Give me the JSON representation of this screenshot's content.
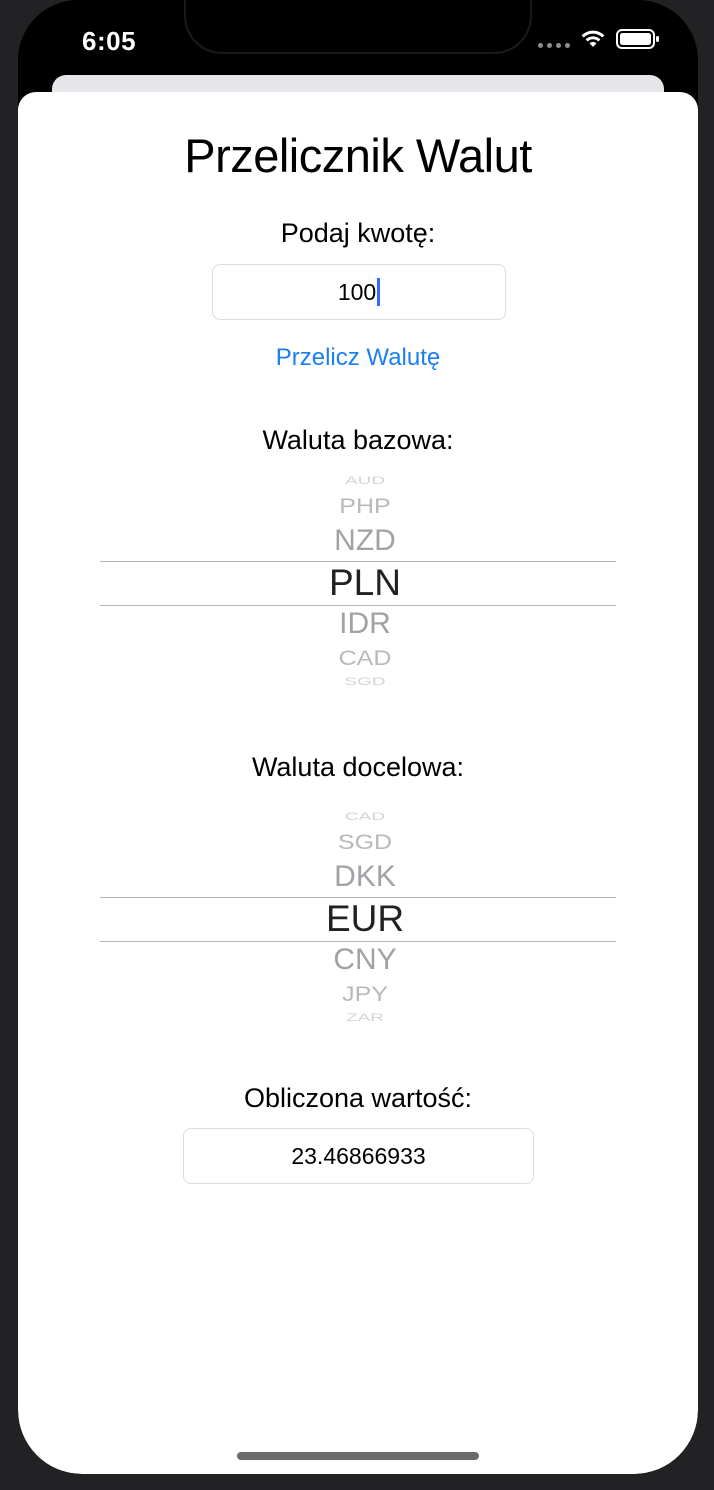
{
  "status_bar": {
    "time": "6:05"
  },
  "app": {
    "title": "Przelicznik Walut",
    "amount_label": "Podaj kwotę:",
    "amount_value": "100",
    "convert_button": "Przelicz Walutę",
    "base_label": "Waluta bazowa:",
    "target_label": "Waluta docelowa:",
    "result_label": "Obliczona wartość:",
    "result_value": "23.46866933"
  },
  "base_picker": {
    "above": [
      "AUD",
      "PHP",
      "NZD"
    ],
    "selected": "PLN",
    "below": [
      "IDR",
      "CAD",
      "SGD"
    ]
  },
  "target_picker": {
    "above": [
      "CAD",
      "SGD",
      "DKK"
    ],
    "selected": "EUR",
    "below": [
      "CNY",
      "JPY",
      "ZAR"
    ]
  }
}
